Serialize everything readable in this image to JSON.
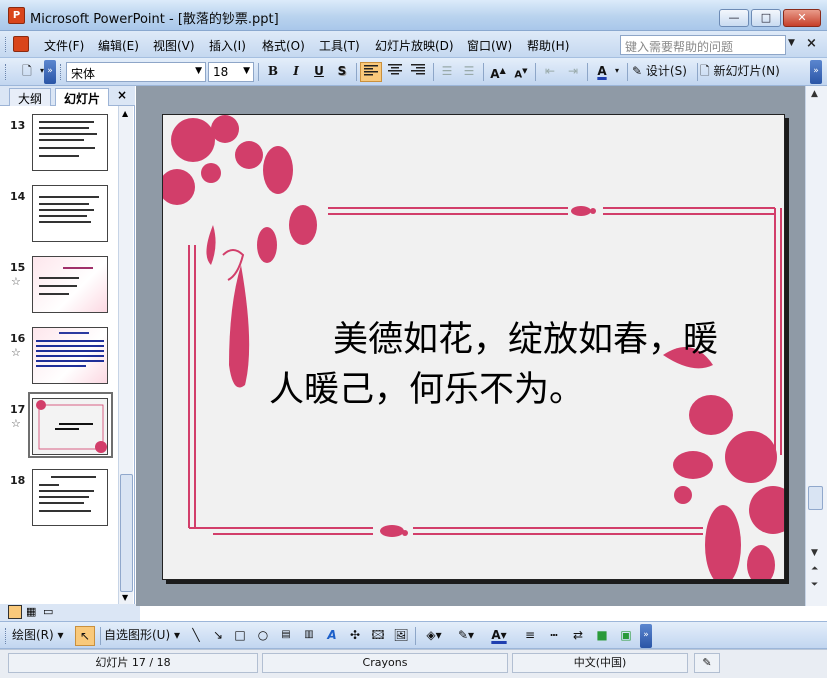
{
  "window": {
    "title": "Microsoft PowerPoint - [散落的钞票.ppt]",
    "app_icon": "powerpoint-icon",
    "min_label": "—",
    "max_label": "□",
    "close_label": "✕"
  },
  "menubar": {
    "items": [
      "文件(F)",
      "编辑(E)",
      "视图(V)",
      "插入(I)",
      "格式(O)",
      "工具(T)",
      "幻灯片放映(D)",
      "窗口(W)",
      "帮助(H)"
    ],
    "help_placeholder": "键入需要帮助的问题",
    "doc_close": "×"
  },
  "toolbar": {
    "new_icon": "new-document-icon",
    "font_name": "宋体",
    "font_size": "18",
    "bold": "B",
    "italic": "I",
    "underline": "U",
    "shadow": "S",
    "align_left_active": true,
    "increase_font": "A",
    "decrease_font": "A",
    "font_color": "A",
    "design_label": "设计(S)",
    "new_slide_label": "新幻灯片(N)"
  },
  "slide_pane": {
    "tab_outline": "大纲",
    "tab_slides": "幻灯片",
    "close": "×",
    "slides": [
      {
        "number": "13",
        "style": "plain",
        "has_star": false
      },
      {
        "number": "14",
        "style": "plain",
        "has_star": false
      },
      {
        "number": "15",
        "style": "pink",
        "has_star": true
      },
      {
        "number": "16",
        "style": "pink-blue",
        "has_star": true
      },
      {
        "number": "17",
        "style": "floral",
        "has_star": true,
        "selected": true
      },
      {
        "number": "18",
        "style": "plain",
        "has_star": false
      }
    ]
  },
  "slide": {
    "text_line1": "美德如花，绽放如春，暖",
    "text_line2": "人暖己，何乐不为。",
    "accent_color": "#d23e6a"
  },
  "drawing_toolbar": {
    "draw_label": "绘图(R)",
    "autoshapes_label": "自选图形(U)"
  },
  "statusbar": {
    "slide_info": "幻灯片 17 / 18",
    "template": "Crayons",
    "language": "中文(中国)"
  }
}
